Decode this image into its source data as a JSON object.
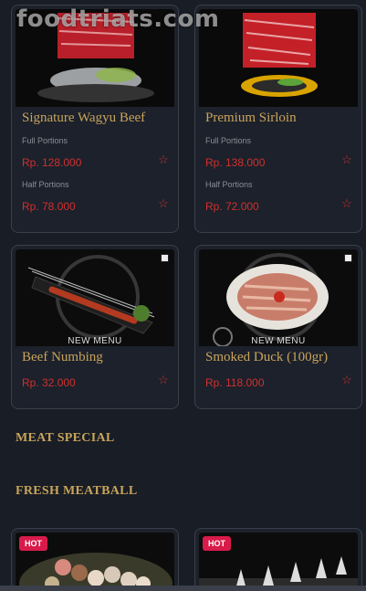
{
  "watermark": "foodtriats.com",
  "cards": [
    {
      "title": "Signature Wagyu Beef",
      "portions": [
        {
          "label": "Full Portions",
          "price": "Rp. 128.000"
        },
        {
          "label": "Half Portions",
          "price": "Rp. 78.000"
        }
      ]
    },
    {
      "title": "Premium Sirloin",
      "portions": [
        {
          "label": "Full Portions",
          "price": "Rp. 138.000"
        },
        {
          "label": "Half Portions",
          "price": "Rp. 72.000"
        }
      ]
    },
    {
      "title": "Beef Numbing",
      "price": "Rp. 32.000",
      "badge": "NEW MENU"
    },
    {
      "title": "Smoked Duck (100gr)",
      "price": "Rp. 118.000",
      "badge": "NEW MENU"
    },
    {
      "badge": "HOT"
    },
    {
      "badge": "HOT"
    }
  ],
  "sections": {
    "meat_special": "MEAT SPECIAL",
    "fresh_meatball": "FRESH MEATBALL"
  },
  "icons": {
    "favorite": "star-outline-icon"
  },
  "colors": {
    "background": "#181d26",
    "gold": "#c9a45a",
    "price_red": "#d0302f",
    "hot_badge": "#d81b4a"
  }
}
